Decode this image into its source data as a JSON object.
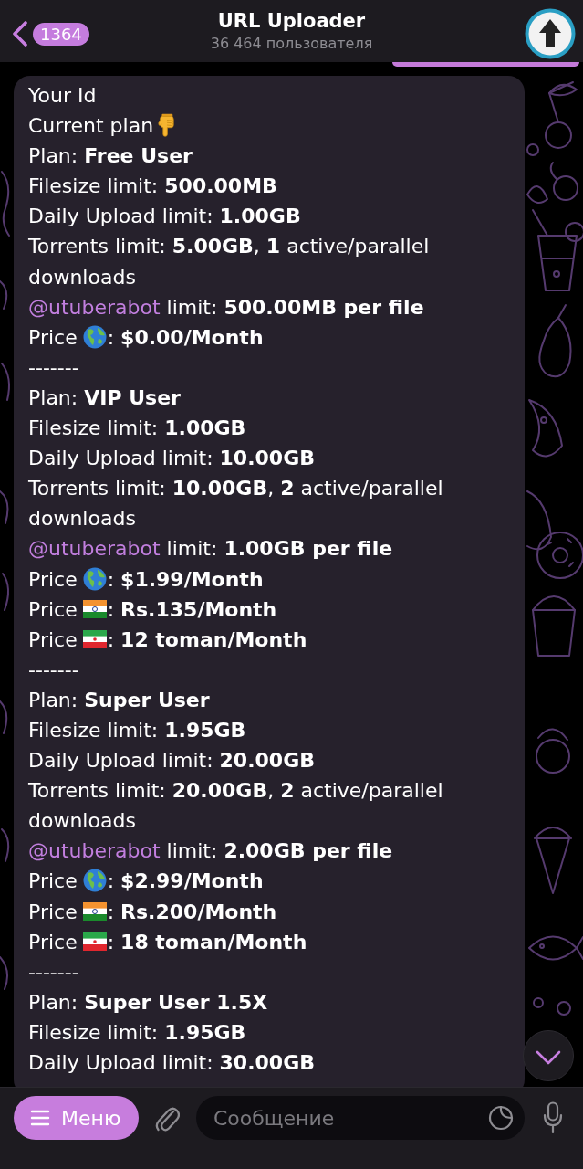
{
  "header": {
    "unread_count": "1364",
    "title": "URL Uploader",
    "subtitle": "36 464 пользователя"
  },
  "message": {
    "lines": [
      {
        "parts": [
          {
            "kind": "text",
            "text": "Your Id"
          }
        ]
      },
      {
        "parts": [
          {
            "kind": "text",
            "text": "Current plan"
          },
          {
            "kind": "pointing_down"
          }
        ]
      },
      {
        "parts": [
          {
            "kind": "text",
            "text": "Plan: **Free User**"
          }
        ]
      },
      {
        "parts": [
          {
            "kind": "text",
            "text": "Filesize limit: **500.00MB**"
          }
        ]
      },
      {
        "parts": [
          {
            "kind": "text",
            "text": "Daily Upload limit: **1.00GB**"
          }
        ]
      },
      {
        "parts": [
          {
            "kind": "text",
            "text": "Torrents limit: **5.00GB**, **1** active/parallel downloads"
          }
        ]
      },
      {
        "parts": [
          {
            "kind": "mention",
            "text": "@utuberabot"
          },
          {
            "kind": "text",
            "text": " limit: **500.00MB per file**"
          }
        ]
      },
      {
        "parts": [
          {
            "kind": "text",
            "text": "Price"
          },
          {
            "kind": "globe"
          },
          {
            "kind": "text",
            "text": ": **$0.00/Month**"
          }
        ]
      },
      {
        "parts": [
          {
            "kind": "text",
            "text": "-------"
          }
        ]
      },
      {
        "parts": [
          {
            "kind": "text",
            "text": "Plan: **VIP User**"
          }
        ]
      },
      {
        "parts": [
          {
            "kind": "text",
            "text": "Filesize limit: **1.00GB**"
          }
        ]
      },
      {
        "parts": [
          {
            "kind": "text",
            "text": "Daily Upload limit: **10.00GB**"
          }
        ]
      },
      {
        "parts": [
          {
            "kind": "text",
            "text": "Torrents limit: **10.00GB**, **2** active/parallel downloads"
          }
        ]
      },
      {
        "parts": [
          {
            "kind": "mention",
            "text": "@utuberabot"
          },
          {
            "kind": "text",
            "text": " limit: **1.00GB per file**"
          }
        ]
      },
      {
        "parts": [
          {
            "kind": "text",
            "text": "Price"
          },
          {
            "kind": "globe"
          },
          {
            "kind": "text",
            "text": ": **$1.99/Month**"
          }
        ]
      },
      {
        "parts": [
          {
            "kind": "text",
            "text": "Price"
          },
          {
            "kind": "flag_india"
          },
          {
            "kind": "text",
            "text": ": **Rs.135/Month**"
          }
        ]
      },
      {
        "parts": [
          {
            "kind": "text",
            "text": "Price"
          },
          {
            "kind": "flag_iran"
          },
          {
            "kind": "text",
            "text": ": **12 toman/Month**"
          }
        ]
      },
      {
        "parts": [
          {
            "kind": "text",
            "text": "-------"
          }
        ]
      },
      {
        "parts": [
          {
            "kind": "text",
            "text": "Plan: **Super User**"
          }
        ]
      },
      {
        "parts": [
          {
            "kind": "text",
            "text": "Filesize limit: **1.95GB**"
          }
        ]
      },
      {
        "parts": [
          {
            "kind": "text",
            "text": "Daily Upload limit: **20.00GB**"
          }
        ]
      },
      {
        "parts": [
          {
            "kind": "text",
            "text": "Torrents limit: **20.00GB**, **2** active/parallel downloads"
          }
        ]
      },
      {
        "parts": [
          {
            "kind": "mention",
            "text": "@utuberabot"
          },
          {
            "kind": "text",
            "text": " limit: **2.00GB per file**"
          }
        ]
      },
      {
        "parts": [
          {
            "kind": "text",
            "text": "Price"
          },
          {
            "kind": "globe"
          },
          {
            "kind": "text",
            "text": ": **$2.99/Month**"
          }
        ]
      },
      {
        "parts": [
          {
            "kind": "text",
            "text": "Price"
          },
          {
            "kind": "flag_india"
          },
          {
            "kind": "text",
            "text": ": **Rs.200/Month**"
          }
        ]
      },
      {
        "parts": [
          {
            "kind": "text",
            "text": "Price"
          },
          {
            "kind": "flag_iran"
          },
          {
            "kind": "text",
            "text": ": **18 toman/Month**"
          }
        ]
      },
      {
        "parts": [
          {
            "kind": "text",
            "text": "-------"
          }
        ]
      },
      {
        "parts": [
          {
            "kind": "text",
            "text": "Plan: **Super User 1.5X**"
          }
        ]
      },
      {
        "parts": [
          {
            "kind": "text",
            "text": "Filesize limit: **1.95GB**"
          }
        ]
      },
      {
        "parts": [
          {
            "kind": "text",
            "text": "Daily Upload limit: **30.00GB**"
          }
        ]
      }
    ]
  },
  "composer": {
    "menu_label": "Меню",
    "placeholder": "Сообщение"
  }
}
